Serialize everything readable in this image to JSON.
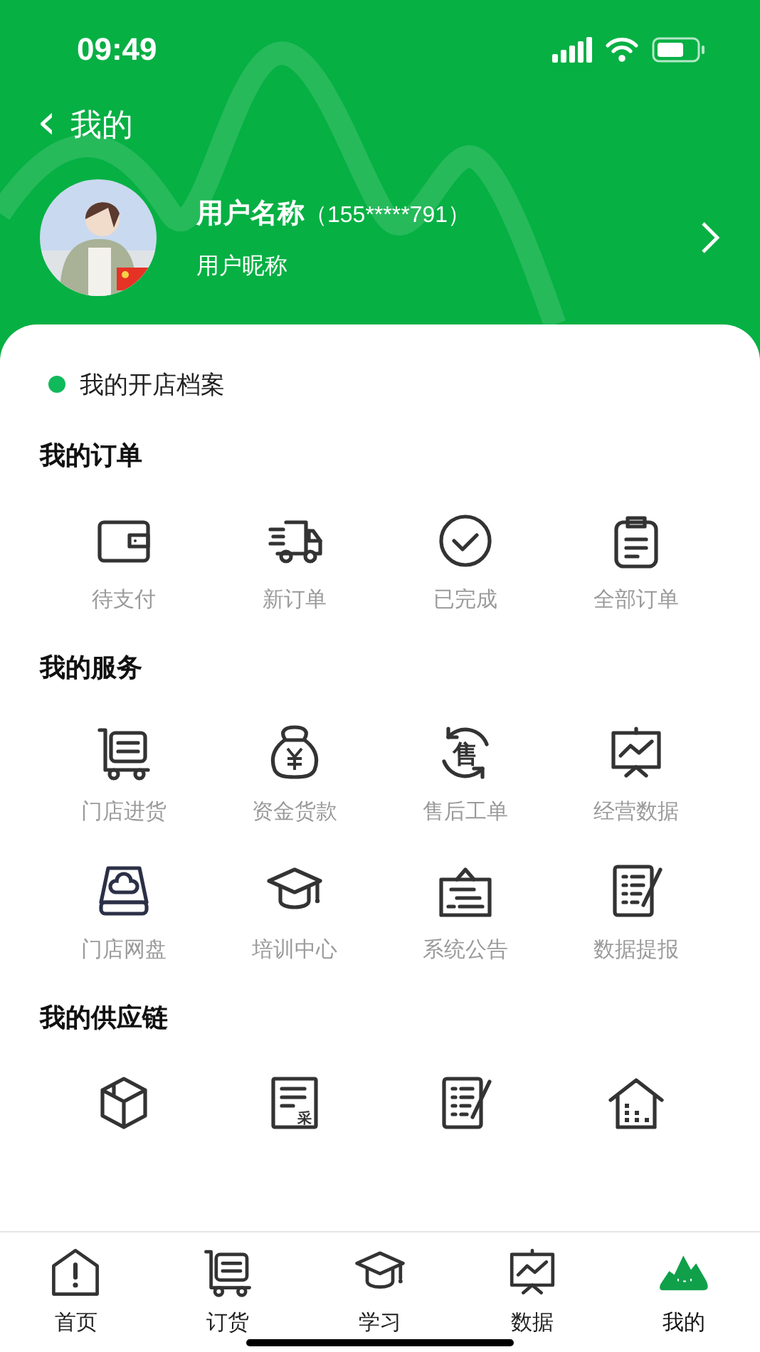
{
  "status_bar": {
    "time": "09:49"
  },
  "nav": {
    "back_icon": "‹",
    "title": "我的"
  },
  "profile": {
    "name": "用户名称",
    "phone": "（155*****791）",
    "nickname": "用户昵称"
  },
  "store_profile": {
    "label": "我的开店档案"
  },
  "sections": [
    {
      "title": "我的订单",
      "items": [
        {
          "kind": "wallet",
          "label": "待支付"
        },
        {
          "kind": "truck",
          "label": "新订单"
        },
        {
          "kind": "check",
          "label": "已完成"
        },
        {
          "kind": "clipboard",
          "label": "全部订单"
        }
      ]
    },
    {
      "title": "我的服务",
      "items": [
        {
          "kind": "cart",
          "label": "门店进货"
        },
        {
          "kind": "moneybag",
          "label": "资金货款"
        },
        {
          "kind": "sale",
          "glyph": "售",
          "label": "售后工单"
        },
        {
          "kind": "presentation",
          "label": "经营数据"
        },
        {
          "kind": "drive",
          "label": "门店网盘"
        },
        {
          "kind": "cap",
          "label": "培训中心"
        },
        {
          "kind": "notice",
          "label": "系统公告"
        },
        {
          "kind": "report",
          "label": "数据提报"
        }
      ]
    },
    {
      "title": "我的供应链",
      "items": [
        {
          "kind": "box"
        },
        {
          "kind": "purchase",
          "glyph": "采"
        },
        {
          "kind": "report"
        },
        {
          "kind": "warehouse"
        }
      ]
    }
  ],
  "tab_bar": [
    {
      "kind": "home",
      "label": "首页",
      "selected": false
    },
    {
      "kind": "cart",
      "label": "订货",
      "selected": false
    },
    {
      "kind": "cap",
      "label": "学习",
      "selected": false
    },
    {
      "kind": "presentation",
      "label": "数据",
      "selected": false
    },
    {
      "kind": "mountain",
      "label": "我的",
      "selected": true
    }
  ]
}
